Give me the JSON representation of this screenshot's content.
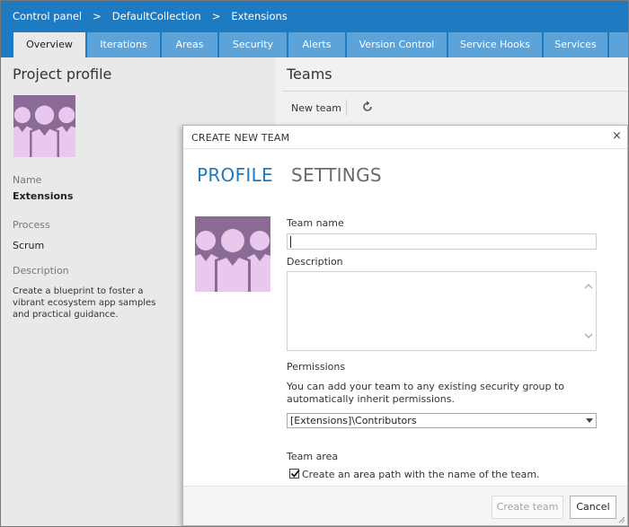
{
  "breadcrumb": {
    "items": [
      "Control panel",
      "DefaultCollection",
      "Extensions"
    ],
    "separator": ">"
  },
  "tabs": [
    {
      "label": "Overview",
      "active": true
    },
    {
      "label": "Iterations",
      "active": false
    },
    {
      "label": "Areas",
      "active": false
    },
    {
      "label": "Security",
      "active": false
    },
    {
      "label": "Alerts",
      "active": false
    },
    {
      "label": "Version Control",
      "active": false
    },
    {
      "label": "Service Hooks",
      "active": false
    },
    {
      "label": "Services",
      "active": false
    }
  ],
  "project": {
    "title": "Project profile",
    "name_label": "Name",
    "name_value": "Extensions",
    "process_label": "Process",
    "process_value": "Scrum",
    "description_label": "Description",
    "description_value": "Create a blueprint to foster a vibrant ecosystem app samples and practical guidance."
  },
  "teams": {
    "title": "Teams",
    "new_team_label": "New team",
    "refresh_icon": "refresh-icon"
  },
  "dialog": {
    "title": "CREATE NEW TEAM",
    "tabs": [
      {
        "label": "PROFILE",
        "active": true
      },
      {
        "label": "SETTINGS",
        "active": false
      }
    ],
    "team_name_label": "Team name",
    "team_name_value": "",
    "description_label": "Description",
    "description_value": "",
    "permissions_label": "Permissions",
    "permissions_text": "You can add your team to any existing security group to automatically inherit permissions.",
    "permissions_selected": "[Extensions]\\Contributors",
    "team_area_label": "Team area",
    "team_area_checkbox_label": "Create an area path with the name of the team.",
    "team_area_checked": true,
    "create_button": "Create team",
    "cancel_button": "Cancel",
    "close_icon": "×"
  },
  "colors": {
    "header_blue": "#1e7bc2",
    "tab_blue": "#5ba3d9",
    "avatar_purple": "#8a6b95",
    "avatar_figure": "#e8c8ec",
    "accent": "#1e7bc2"
  }
}
